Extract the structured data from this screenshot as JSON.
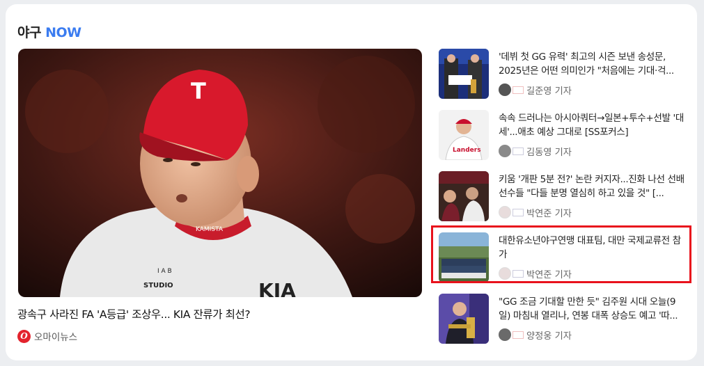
{
  "section": {
    "title_prefix": "야구",
    "title_accent": "NOW"
  },
  "hero": {
    "title": "광속구 사라진 FA 'A등급' 조상우... KIA 잔류가 최선?",
    "source": "오마이뉴스",
    "source_logo_letter": "O",
    "cap_letter": "T",
    "jersey_collar": "KAMISTA",
    "jersey_badge_top": "I A B",
    "jersey_badge": "STUDIO",
    "jersey_logo": "KIA"
  },
  "articles": [
    {
      "title": "'데뷔 첫 GG 유력' 최고의 시즌 보낸 송성문, 2025년은 어떤 의미인가 \"처음에는 기대·걱...",
      "reporter": "길준영 기자"
    },
    {
      "title": "속속 드러나는 아시아쿼터→일본+투수+선발 '대세'...애초 예상 그대로 [SS포커스]",
      "reporter": "김동영 기자"
    },
    {
      "title": "키움 '개판 5분 전?' 논란 커지자...진화 나선 선배 선수들 \"다들 분명 열심히 하고 있을 것\" [...",
      "reporter": "박연준 기자"
    },
    {
      "title": "대한유소년야구연맹 대표팀, 대만 국제교류전 참가",
      "reporter": "박연준 기자"
    },
    {
      "title": "\"GG 조금 기대할 만한 듯\" 김주원 시대 오늘(9일) 마침내 열리나, 연봉 대폭 상승도 예고 '따...",
      "reporter": "양정웅 기자"
    }
  ],
  "colors": {
    "accent": "#3b7cf0",
    "highlight": "#e8121c",
    "kia_red": "#d8192c"
  }
}
